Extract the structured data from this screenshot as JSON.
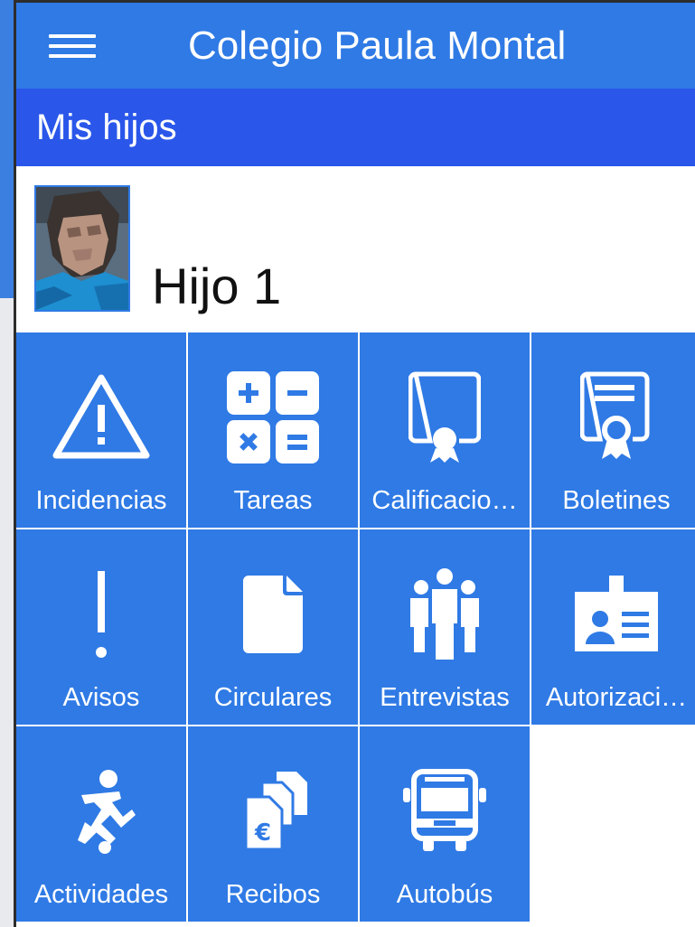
{
  "app": {
    "title": "Colegio Paula Montal"
  },
  "section": {
    "title": "Mis hijos"
  },
  "child": {
    "name": "Hijo 1"
  },
  "colors": {
    "appbar": "#2f7ae5",
    "section": "#2a57ea",
    "tile": "#2f7ae5"
  },
  "tiles": [
    {
      "label": "Incidencias",
      "icon": "warning-icon"
    },
    {
      "label": "Tareas",
      "icon": "calculator-icon"
    },
    {
      "label": "Calificacio…",
      "icon": "certificate-icon"
    },
    {
      "label": "Boletines",
      "icon": "report-card-icon"
    },
    {
      "label": "Avisos",
      "icon": "exclamation-icon"
    },
    {
      "label": "Circulares",
      "icon": "document-icon"
    },
    {
      "label": "Entrevistas",
      "icon": "people-icon"
    },
    {
      "label": "Autorizaci…",
      "icon": "id-badge-icon"
    },
    {
      "label": "Actividades",
      "icon": "soccer-player-icon"
    },
    {
      "label": "Recibos",
      "icon": "euro-receipts-icon"
    },
    {
      "label": "Autobús",
      "icon": "bus-icon"
    }
  ]
}
